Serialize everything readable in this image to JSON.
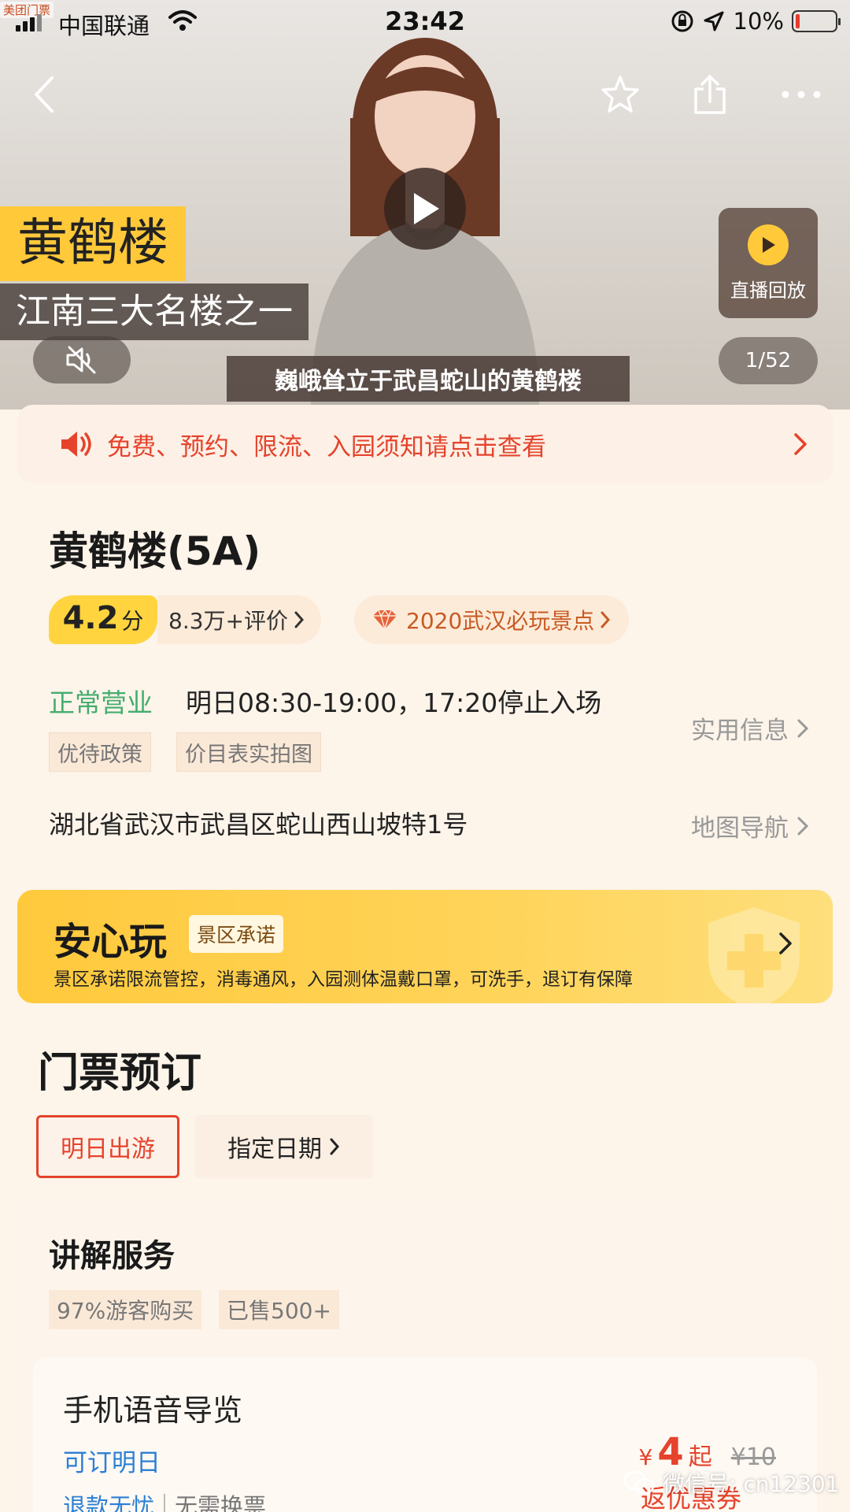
{
  "status_bar": {
    "brand": "美团门票",
    "carrier": "中国联通",
    "time": "23:42",
    "battery_pct": "10%",
    "battery_level": 0.1
  },
  "hero": {
    "title": "黄鹤楼",
    "subtitle": "江南三大名楼之一",
    "caption": "巍峨耸立于武昌蛇山的黄鹤楼",
    "replay_label": "直播回放",
    "counter": "1/52"
  },
  "notice": {
    "text": "免费、预约、限流、入园须知请点击查看"
  },
  "info": {
    "name": "黄鹤楼(5A)",
    "score": "4.2",
    "score_unit": "分",
    "reviews": "8.3万+评价",
    "honor": "2020武汉必玩景点",
    "status": "正常营业",
    "hours": "明日08:30-19:00，17:20停止入场",
    "tags": [
      "优待政策",
      "价目表实拍图"
    ],
    "practical_link": "实用信息",
    "address": "湖北省武汉市武昌区蛇山西山坡特1号",
    "map_link": "地图导航"
  },
  "safe": {
    "title": "安心玩",
    "badge": "景区承诺",
    "desc": "景区承诺限流管控，消毒通风，入园测体温戴口罩，可洗手，退订有保障"
  },
  "tickets": {
    "title": "门票预订",
    "date_tomorrow": "明日出游",
    "date_pick": "指定日期"
  },
  "service": {
    "title": "讲解服务",
    "tags": [
      "97%游客购买",
      "已售500+"
    ],
    "product": {
      "name": "手机语音导览",
      "booking": "可订明日",
      "feature": "退款无忧",
      "feature2": "无需换票",
      "price_symbol": "¥",
      "price": "4",
      "price_suffix": "起",
      "original_price": "¥10",
      "coupon": "返优惠券"
    }
  },
  "watermark": "微信号: cn12301",
  "icons": {
    "back": "back-arrow-icon",
    "favorite": "star-icon",
    "share": "share-icon",
    "more": "more-icon",
    "play": "play-icon",
    "mute": "mute-icon",
    "speaker": "speaker-icon",
    "diamond": "diamond-icon",
    "chevron": "chevron-right-icon"
  },
  "colors": {
    "accent_red": "#e5432c",
    "brand_yellow": "#ffc93a",
    "open_green": "#44ad6e",
    "link_blue": "#2b7fd6",
    "buy_orange": "#ff6a1f"
  }
}
